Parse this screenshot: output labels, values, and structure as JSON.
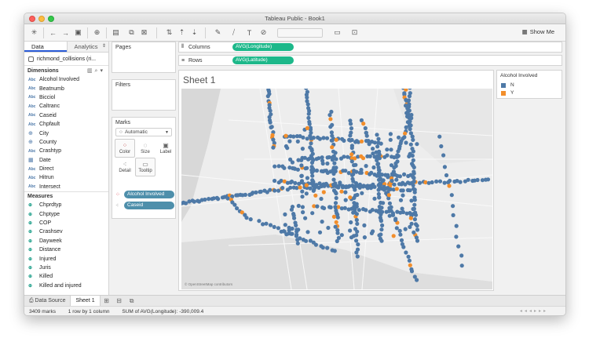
{
  "window": {
    "title": "Tableau Public - Book1"
  },
  "toolbar": {
    "show_me": "Show Me"
  },
  "left_pane": {
    "tabs": [
      {
        "label": "Data"
      },
      {
        "label": "Analytics"
      }
    ],
    "datasource": "richmond_collisions (ri...",
    "dimensions_header": "Dimensions",
    "dimensions": [
      {
        "type": "Abc",
        "name": "Alcohol Involved"
      },
      {
        "type": "Abc",
        "name": "Beatnumb"
      },
      {
        "type": "Abc",
        "name": "Bicciol"
      },
      {
        "type": "Abc",
        "name": "Caltranc"
      },
      {
        "type": "Abc",
        "name": "Caseid"
      },
      {
        "type": "Abc",
        "name": "Chpfault"
      },
      {
        "type": "geo",
        "name": "City"
      },
      {
        "type": "geo",
        "name": "County"
      },
      {
        "type": "Abc",
        "name": "Crashtyp"
      },
      {
        "type": "date",
        "name": "Date"
      },
      {
        "type": "Abc",
        "name": "Direct"
      },
      {
        "type": "Abc",
        "name": "Hitrun"
      },
      {
        "type": "Abc",
        "name": "Intersect"
      }
    ],
    "measures_header": "Measures",
    "measures": [
      {
        "type": "#",
        "name": "Chprdtyp"
      },
      {
        "type": "#",
        "name": "Chptype"
      },
      {
        "type": "#",
        "name": "COP"
      },
      {
        "type": "#",
        "name": "Crashsev"
      },
      {
        "type": "#",
        "name": "Dayweek"
      },
      {
        "type": "#",
        "name": "Distance"
      },
      {
        "type": "#",
        "name": "Injured"
      },
      {
        "type": "#",
        "name": "Juris"
      },
      {
        "type": "#",
        "name": "Killed"
      },
      {
        "type": "#",
        "name": "Killed and injured"
      }
    ]
  },
  "cards": {
    "pages": "Pages",
    "filters": "Filters",
    "marks": "Marks",
    "mark_type": "Automatic",
    "mark_buttons": [
      {
        "label": "Color",
        "icon": "color-icon"
      },
      {
        "label": "Size",
        "icon": "size-icon"
      },
      {
        "label": "Label",
        "icon": "label-icon"
      },
      {
        "label": "Detail",
        "icon": "detail-icon"
      },
      {
        "label": "Tooltip",
        "icon": "tooltip-icon"
      }
    ],
    "mark_pills": [
      {
        "label": "Alcohol Involved"
      },
      {
        "label": "Caseid"
      }
    ]
  },
  "shelves": {
    "columns_label": "Columns",
    "columns_pill": "AVG(Longitude)",
    "rows_label": "Rows",
    "rows_pill": "AVG(Latitude)"
  },
  "sheet": {
    "title": "Sheet 1",
    "attribution": "© OpenStreetMap contributors"
  },
  "legend": {
    "title": "Alcohol Involved",
    "items": [
      {
        "label": "N",
        "color": "#4e79a7"
      },
      {
        "label": "Y",
        "color": "#f28e2b"
      }
    ]
  },
  "bottom_tabs": {
    "data_source": "Data Source",
    "sheet": "Sheet 1"
  },
  "status": {
    "marks": "3409 marks",
    "rows_cols": "1 row by 1 column",
    "sum": "SUM of AVG(Longitude): -390,009.4"
  },
  "colors": {
    "accent_green": "#1db88a",
    "accent_teal": "#4e8fab",
    "mark_blue": "#4e79a7",
    "mark_orange": "#f28e2b"
  }
}
